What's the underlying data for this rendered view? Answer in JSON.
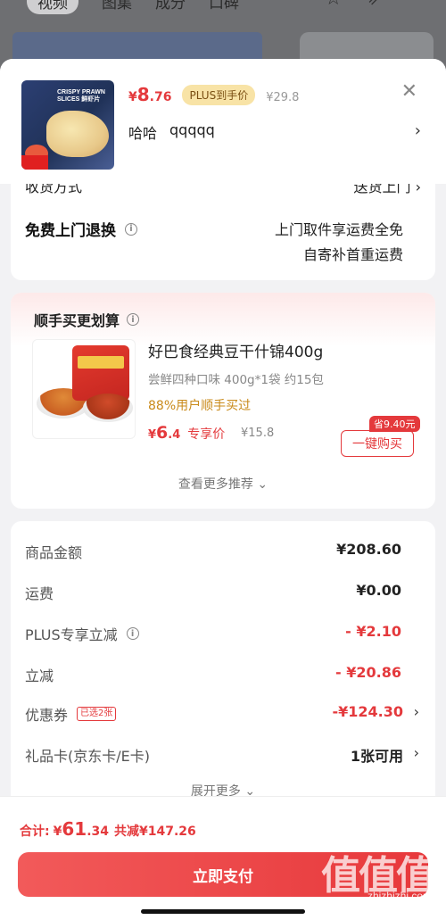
{
  "background": {
    "tabs": [
      "视频",
      "图集",
      "成分",
      "口碑"
    ],
    "icons": [
      "star-icon",
      "share-icon",
      "more-icon"
    ]
  },
  "product": {
    "price_currency": "¥",
    "price_int": "8",
    "price_dec": ".76",
    "plus_badge": "PLUS到手价",
    "orig_price": "¥29.8",
    "spec_1": "哈哈",
    "spec_2": "qqqqq",
    "thumb_text": "CRISPY PRAWN SLICES 鲜虾片"
  },
  "delivery": {
    "cut_label": "收货方式",
    "cut_value": "送货上门 ›",
    "return_label": "免费上门退换",
    "return_line1": "上门取件享运费全免",
    "return_line2": "自寄补首重运费"
  },
  "recommend": {
    "title": "顺手买更划算",
    "name": "好巴食经典豆干什锦400g",
    "spec": "尝鲜四种口味 400g*1袋 约15包",
    "stat": "88%用户顺手买过",
    "price_currency": "¥",
    "price_int": "6",
    "price_dec": ".4",
    "price_label": "专享价",
    "orig_price": "¥15.8",
    "save_badge": "省9.40元",
    "buy_button": "一键购买",
    "more": "查看更多推荐 ⌄"
  },
  "summary": {
    "rows": [
      {
        "label": "商品金额",
        "value": "¥208.60"
      },
      {
        "label": "运费",
        "value": "¥0.00"
      },
      {
        "label": "PLUS专享立减",
        "value": "- ¥2.10"
      },
      {
        "label": "立减",
        "value": "- ¥20.86"
      },
      {
        "label": "优惠券",
        "badge": "已选2张",
        "value": "-¥124.30"
      },
      {
        "label": "礼品卡(京东卡/E卡)",
        "value": "1张可用"
      }
    ],
    "expand": "展开更多 ⌄"
  },
  "bottom": {
    "total_label": "合计:",
    "total_currency": "¥",
    "total_int": "61",
    "total_dec": ".34",
    "saved": "共减¥147.26",
    "pay_button": "立即支付"
  },
  "watermark": {
    "logo": "值值值",
    "site": "zhizhizhi.com"
  },
  "colors": {
    "accent": "#e4393c",
    "plus_badge_bg": "#f8e3a6",
    "stat_text": "#c98a1a"
  }
}
